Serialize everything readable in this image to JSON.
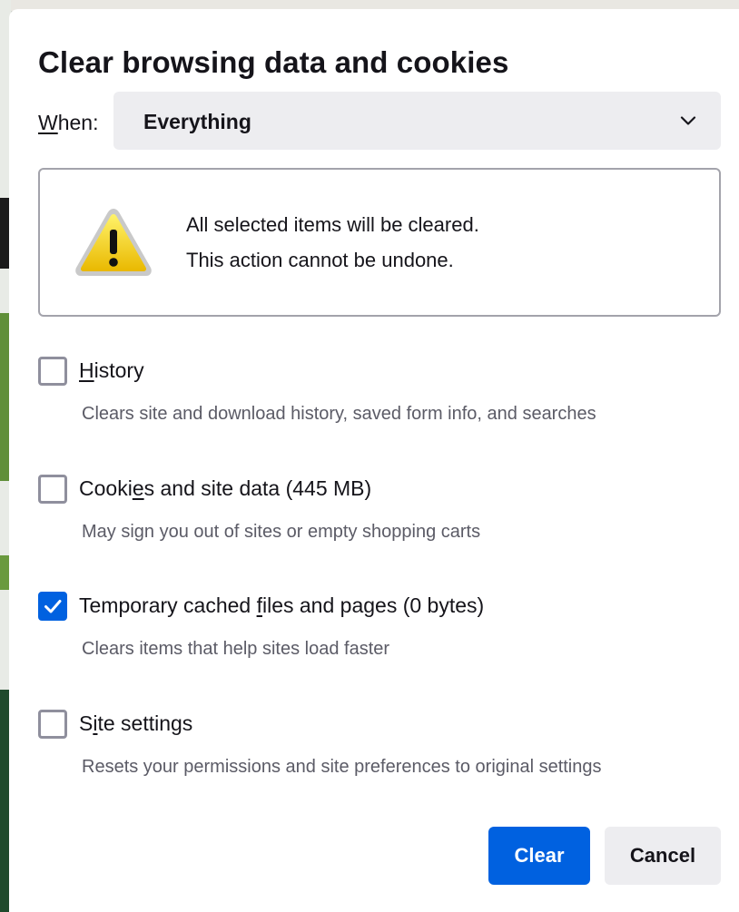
{
  "dialog": {
    "title": "Clear browsing data and cookies",
    "when": {
      "label_access": "W",
      "label_rest": "hen:",
      "value": "Everything"
    },
    "warning": {
      "line1": "All selected items will be cleared.",
      "line2": "This action cannot be undone."
    },
    "options": [
      {
        "pre": "",
        "access": "H",
        "post": "istory",
        "description": "Clears site and download history, saved form info, and searches",
        "checked": false
      },
      {
        "pre": "Cooki",
        "access": "e",
        "post": "s and site data (445 MB)",
        "description": "May sign you out of sites or empty shopping carts",
        "checked": false
      },
      {
        "pre": "Temporary cached ",
        "access": "f",
        "post": "iles and pages (0 bytes)",
        "description": "Clears items that help sites load faster",
        "checked": true
      },
      {
        "pre": "S",
        "access": "i",
        "post": "te settings",
        "description": "Resets your permissions and site preferences to original settings",
        "checked": false
      }
    ],
    "buttons": {
      "clear": "Clear",
      "cancel": "Cancel"
    }
  },
  "colors": {
    "accent": "#0061e0",
    "button_secondary": "#ededf0",
    "text": "#15141a",
    "muted_text": "#5b5b66",
    "checkbox_border": "#8f8f9d"
  },
  "icons": {
    "warning": "warning-triangle-icon",
    "dropdown": "chevron-down-icon",
    "check": "checkmark-icon"
  }
}
